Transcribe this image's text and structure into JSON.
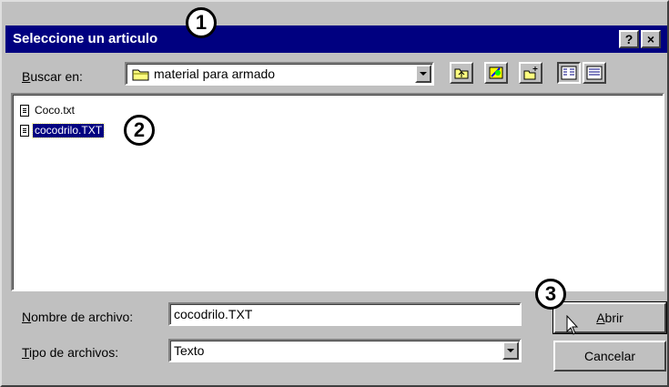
{
  "dialog": {
    "title": "Seleccione un articulo",
    "help_button": "?",
    "close_button": "×"
  },
  "look_in": {
    "label_first": "B",
    "label_rest": "uscar en:",
    "folder": "material para armado"
  },
  "files": [
    {
      "name": "Coco.txt",
      "selected": false
    },
    {
      "name": "cocodrilo.TXT",
      "selected": true
    }
  ],
  "filename": {
    "label_first": "N",
    "label_rest": "ombre de archivo:",
    "value": "cocodrilo.TXT"
  },
  "filetype": {
    "label_first": "T",
    "label_rest": "ipo de archivos:",
    "value": "Texto"
  },
  "buttons": {
    "open_first": "A",
    "open_rest": "brir",
    "cancel": "Cancelar"
  },
  "callouts": [
    "1",
    "2",
    "3"
  ],
  "colors": {
    "title_bar": "#000080",
    "window_face": "#c0c0c0",
    "selection": "#000080"
  },
  "icons": {
    "up_folder": "up-folder-icon",
    "desktop": "desktop-icon",
    "new_folder": "new-folder-icon",
    "list_view": "list-view-icon",
    "details_view": "details-view-icon",
    "folder": "folder-icon",
    "file": "text-file-icon",
    "cursor": "mouse-pointer-icon"
  }
}
